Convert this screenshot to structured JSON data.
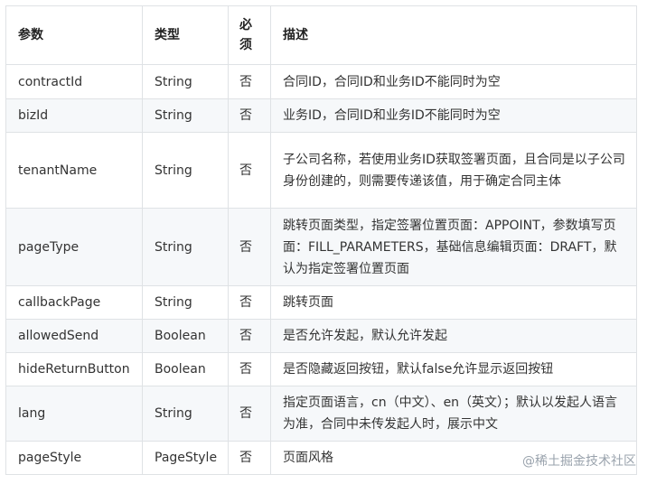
{
  "table": {
    "headers": {
      "param": "参数",
      "type": "类型",
      "required": "必须",
      "desc": "描述"
    },
    "rows": [
      {
        "param": "contractId",
        "type": "String",
        "required": "否",
        "desc": "合同ID，合同ID和业务ID不能同时为空"
      },
      {
        "param": "bizId",
        "type": "String",
        "required": "否",
        "desc": "业务ID，合同ID和业务ID不能同时为空"
      },
      {
        "param": "tenantName",
        "type": "String",
        "required": "否",
        "desc": "子公司名称，若使用业务ID获取签署页面，且合同是以子公司身份创建的，则需要传递该值，用于确定合同主体"
      },
      {
        "param": "pageType",
        "type": "String",
        "required": "否",
        "desc": "跳转页面类型，指定签署位置页面：APPOINT，参数填写页面：FILL_PARAMETERS，基础信息编辑页面：DRAFT，默认为指定签署位置页面"
      },
      {
        "param": "callbackPage",
        "type": "String",
        "required": "否",
        "desc": "跳转页面"
      },
      {
        "param": "allowedSend",
        "type": "Boolean",
        "required": "否",
        "desc": "是否允许发起，默认允许发起"
      },
      {
        "param": "hideReturnButton",
        "type": "Boolean",
        "required": "否",
        "desc": "是否隐藏返回按钮，默认false允许显示返回按钮"
      },
      {
        "param": "lang",
        "type": "String",
        "required": "否",
        "desc": "指定页面语言，cn（中文）、en（英文）；默认以发起人语言为准，合同中未传发起人时，展示中文"
      },
      {
        "param": "pageStyle",
        "type": "PageStyle",
        "required": "否",
        "desc": "页面风格"
      }
    ]
  },
  "watermark": "@稀土掘金技术社区"
}
